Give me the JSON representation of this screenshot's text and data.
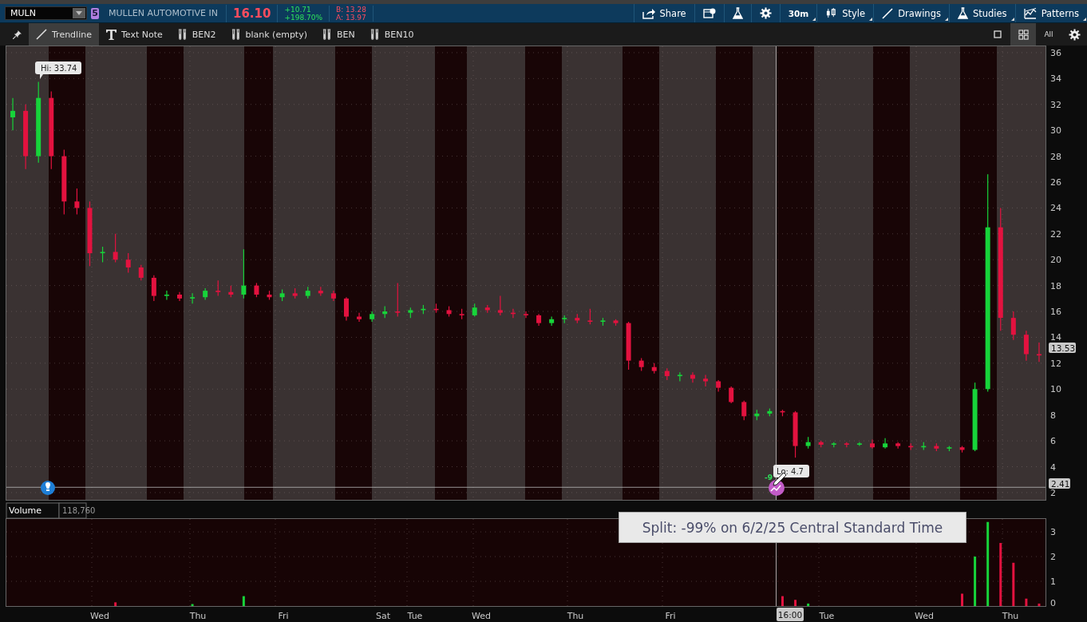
{
  "symbol_bar": {
    "symbol": "MULN",
    "badge": "5",
    "company": "MULLEN AUTOMOTIVE IN",
    "last": "16.10",
    "change": "+10.71",
    "change_pct": "+198.70%",
    "bid": "B: 13.28",
    "ask": "A: 13.97"
  },
  "header_buttons": [
    {
      "kind": "share",
      "label": "Share"
    },
    {
      "kind": "alert"
    },
    {
      "kind": "flask"
    },
    {
      "kind": "gear"
    },
    {
      "kind": "text",
      "label": "30m"
    },
    {
      "kind": "style",
      "label": "Style"
    },
    {
      "kind": "drawings",
      "label": "Drawings"
    },
    {
      "kind": "studies",
      "label": "Studies"
    },
    {
      "kind": "patterns",
      "label": "Patterns"
    }
  ],
  "drawing_tools": [
    {
      "kind": "pin",
      "selected": false
    },
    {
      "kind": "line",
      "label": "Trendline",
      "selected": true
    },
    {
      "kind": "text",
      "label": "Text Note",
      "selected": false
    },
    {
      "kind": "flask",
      "label": "BEN2",
      "selected": false
    },
    {
      "kind": "flask",
      "label": "blank (empty)",
      "selected": false
    },
    {
      "kind": "flask",
      "label": "BEN",
      "selected": false
    },
    {
      "kind": "flask",
      "label": "BEN10",
      "selected": false
    }
  ],
  "layout_buttons": [
    {
      "kind": "single",
      "selected": false
    },
    {
      "kind": "grid",
      "selected": true
    },
    {
      "kind": "text",
      "label": "All",
      "selected": false
    },
    {
      "kind": "gear",
      "selected": false
    }
  ],
  "price_chart": {
    "hi_label": "Hi: 33.74",
    "lo_label": "Lo: 4.7",
    "split_marker_text": "-9",
    "last_price_tag": "13.53",
    "line_price_tag": "2.41",
    "chart_data": {
      "type": "candlestick",
      "grid": true,
      "ylim": [
        1.44,
        36.49
      ],
      "ref_lines": [
        {
          "axis": "y",
          "value": 2.41
        }
      ],
      "yticks": [
        36,
        34,
        32,
        30,
        28,
        26,
        24,
        22,
        20,
        18,
        16,
        14,
        12,
        10,
        8,
        6,
        4,
        2
      ],
      "ohlc": [
        [
          31,
          32.5,
          30,
          31.5
        ],
        [
          31.5,
          32,
          27,
          28
        ],
        [
          28,
          33.74,
          27.5,
          32.5
        ],
        [
          32.5,
          33,
          27,
          28
        ],
        [
          28,
          28.5,
          23.5,
          24.5
        ],
        [
          24.5,
          25.5,
          23.5,
          24
        ],
        [
          24,
          24.5,
          19.5,
          20.5
        ],
        [
          20.5,
          21,
          19.8,
          20.6
        ],
        [
          20.6,
          22,
          19.8,
          20
        ],
        [
          20,
          20.5,
          19,
          19.4
        ],
        [
          19.4,
          19.6,
          18.4,
          18.6
        ],
        [
          18.6,
          18.8,
          16.8,
          17.2
        ],
        [
          17.2,
          17.6,
          16.9,
          17.3
        ],
        [
          17.3,
          17.5,
          16.8,
          17
        ],
        [
          17,
          17.4,
          16.6,
          17.1
        ],
        [
          17.1,
          17.8,
          16.9,
          17.6
        ],
        [
          17.6,
          18.4,
          17.2,
          17.5
        ],
        [
          17.5,
          18,
          17.1,
          17.3
        ],
        [
          17.3,
          20.8,
          17,
          18
        ],
        [
          18,
          18.2,
          17.1,
          17.3
        ],
        [
          17.3,
          17.6,
          16.9,
          17.1
        ],
        [
          17.1,
          17.7,
          16.8,
          17.4
        ],
        [
          17.4,
          17.8,
          17,
          17.2
        ],
        [
          17.2,
          17.9,
          17,
          17.6
        ],
        [
          17.6,
          17.9,
          17.2,
          17.4
        ],
        [
          17.4,
          17.6,
          16.8,
          17
        ],
        [
          17,
          17.1,
          15.3,
          15.6
        ],
        [
          15.6,
          15.9,
          15.2,
          15.4
        ],
        [
          15.4,
          16,
          15.2,
          15.8
        ],
        [
          15.8,
          16.4,
          15.5,
          16
        ],
        [
          16,
          18.2,
          15.6,
          15.9
        ],
        [
          15.9,
          16.3,
          15.5,
          16.1
        ],
        [
          16.1,
          16.5,
          15.8,
          16.2
        ],
        [
          16.2,
          16.6,
          15.9,
          16.1
        ],
        [
          16.1,
          16.4,
          15.6,
          15.8
        ],
        [
          15.8,
          16.2,
          15.4,
          15.7
        ],
        [
          15.7,
          16.6,
          15.6,
          16.3
        ],
        [
          16.3,
          16.5,
          15.9,
          16.1
        ],
        [
          16.1,
          17.2,
          15.7,
          15.9
        ],
        [
          15.9,
          16.2,
          15.5,
          15.8
        ],
        [
          15.8,
          16,
          15.5,
          15.7
        ],
        [
          15.7,
          15.8,
          14.9,
          15.1
        ],
        [
          15.1,
          15.6,
          14.9,
          15.4
        ],
        [
          15.4,
          15.7,
          15.1,
          15.5
        ],
        [
          15.5,
          15.8,
          15.1,
          15.3
        ],
        [
          15.3,
          16.2,
          15,
          15.2
        ],
        [
          15.2,
          15.5,
          14.9,
          15.3
        ],
        [
          15.3,
          15.4,
          14.9,
          15.1
        ],
        [
          15.1,
          15.2,
          11.5,
          12.2
        ],
        [
          12.2,
          12.4,
          11.4,
          11.7
        ],
        [
          11.7,
          12,
          11.2,
          11.4
        ],
        [
          11.4,
          11.6,
          10.7,
          11
        ],
        [
          11,
          11.3,
          10.6,
          11.1
        ],
        [
          11.1,
          11.3,
          10.5,
          10.8
        ],
        [
          10.8,
          11.1,
          10.2,
          10.6
        ],
        [
          10.6,
          10.7,
          9.8,
          10.1
        ],
        [
          10.1,
          10.2,
          8.9,
          9
        ],
        [
          9,
          9.1,
          7.6,
          7.9
        ],
        [
          7.9,
          8.4,
          7.6,
          8.1
        ],
        [
          8.1,
          8.5,
          7.9,
          8.3
        ],
        [
          8.3,
          8.4,
          7.9,
          8.2
        ],
        [
          8.2,
          8.3,
          4.7,
          5.6
        ],
        [
          5.6,
          6.3,
          5.4,
          5.9
        ],
        [
          5.9,
          6,
          5.5,
          5.7
        ],
        [
          5.7,
          5.9,
          5.5,
          5.8
        ],
        [
          5.8,
          5.9,
          5.5,
          5.7
        ],
        [
          5.7,
          5.9,
          5.6,
          5.8
        ],
        [
          5.8,
          6.1,
          5.4,
          5.5
        ],
        [
          5.5,
          6.2,
          5.4,
          5.8
        ],
        [
          5.8,
          5.9,
          5.4,
          5.6
        ],
        [
          5.6,
          5.8,
          5.3,
          5.5
        ],
        [
          5.5,
          5.9,
          5.3,
          5.6
        ],
        [
          5.6,
          5.8,
          5.2,
          5.4
        ],
        [
          5.4,
          5.6,
          5.2,
          5.5
        ],
        [
          5.5,
          5.6,
          5.1,
          5.3
        ],
        [
          5.3,
          10.5,
          5.2,
          10
        ],
        [
          10,
          26.6,
          9.8,
          22.5
        ],
        [
          22.5,
          24,
          14.5,
          15.5
        ],
        [
          15.5,
          16,
          13.8,
          14.2
        ],
        [
          14.2,
          14.5,
          12.2,
          12.7
        ],
        [
          12.7,
          13.6,
          12.1,
          12.6
        ]
      ]
    }
  },
  "volume_panel": {
    "title": "Volume",
    "value": "118,760",
    "chart_data": {
      "type": "bar",
      "grid": true,
      "ylim": [
        0,
        3.52
      ],
      "yticks": [
        3,
        2,
        1,
        0
      ],
      "values": [
        0,
        0,
        0,
        0,
        0,
        0,
        0,
        0,
        0.15,
        0,
        0,
        0,
        0,
        0,
        0.08,
        0,
        0,
        0,
        0.4,
        0,
        0,
        0,
        0,
        0,
        0,
        0,
        0,
        0,
        0,
        0,
        0,
        0,
        0,
        0,
        0,
        0,
        0,
        0,
        0,
        0,
        0,
        0,
        0,
        0,
        0,
        0,
        0,
        0,
        0,
        0,
        0,
        0,
        0,
        0,
        0,
        0,
        0,
        0,
        0,
        0,
        0.4,
        0.25,
        0.1,
        0,
        0,
        0,
        0,
        0,
        0,
        0,
        0,
        0,
        0,
        0,
        0.5,
        2.0,
        3.4,
        2.55,
        1.75,
        0.3,
        0.1
      ]
    }
  },
  "time_axis": {
    "labels": [
      "Wed",
      "Thu",
      "Fri",
      "Sat",
      "Tue",
      "Wed",
      "Thu",
      "Fri",
      "Tue",
      "Wed",
      "Thu"
    ],
    "cursor_time": "16:00"
  },
  "tooltip": "Split: -99% on 6/2/25 Central Standard Time"
}
